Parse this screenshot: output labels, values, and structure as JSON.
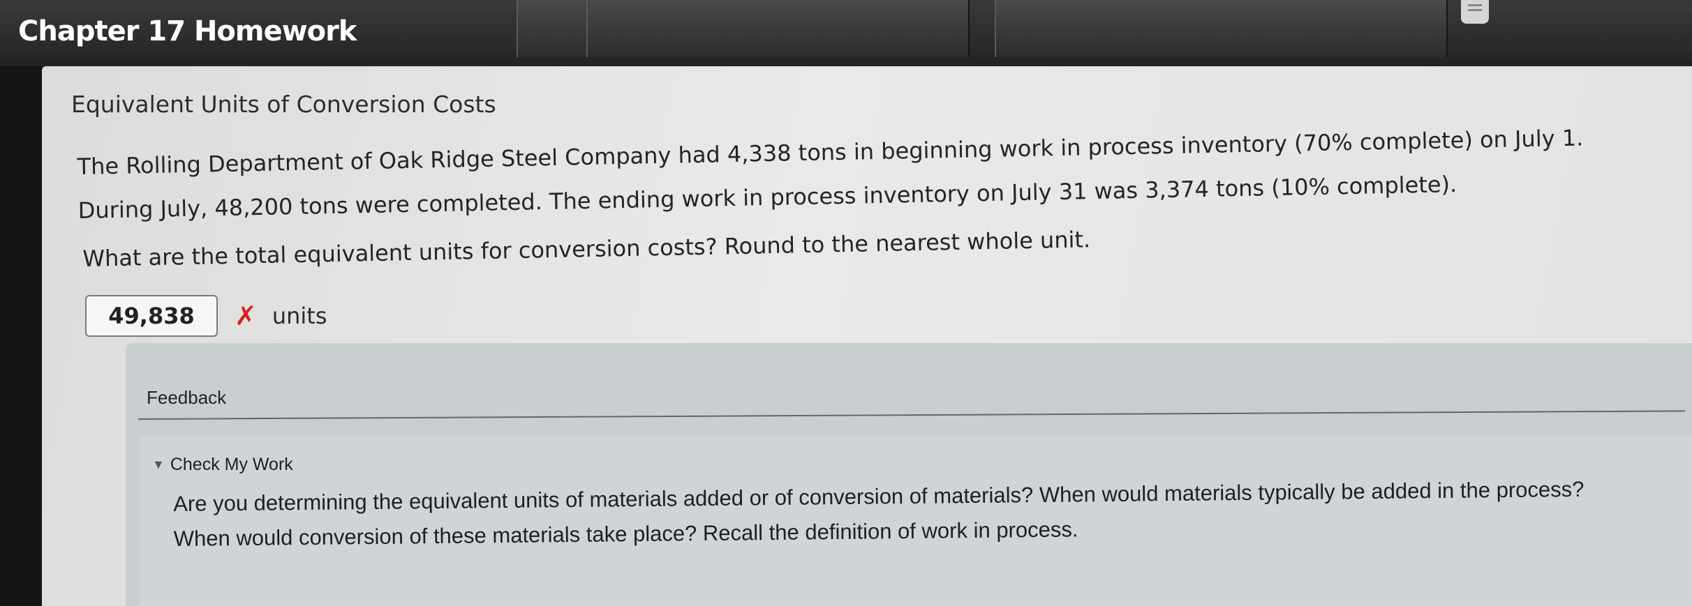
{
  "header": {
    "chapter_title": "Chapter 17 Homework"
  },
  "problem": {
    "title": "Equivalent Units of Conversion Costs",
    "paragraph_line1": "The Rolling Department of Oak Ridge Steel Company had 4,338 tons in beginning work in process inventory (70% complete) on July 1.",
    "paragraph_line2": "During July, 48,200 tons were completed. The ending work in process inventory on July 31 was 3,374 tons (10% complete).",
    "question": "What are the total equivalent units for conversion costs? Round to the nearest whole unit.",
    "answer_value": "49,838",
    "answer_status_icon": "✗",
    "answer_unit": "units",
    "status_color": "#d8221f"
  },
  "feedback": {
    "title": "Feedback",
    "check_my_work": "Check My Work",
    "hint_line1": "Are you determining the equivalent units of materials added or of conversion of materials? When would materials typically be added in the process?",
    "hint_line2": "When would conversion of these materials take place? Recall the definition of work in process."
  }
}
